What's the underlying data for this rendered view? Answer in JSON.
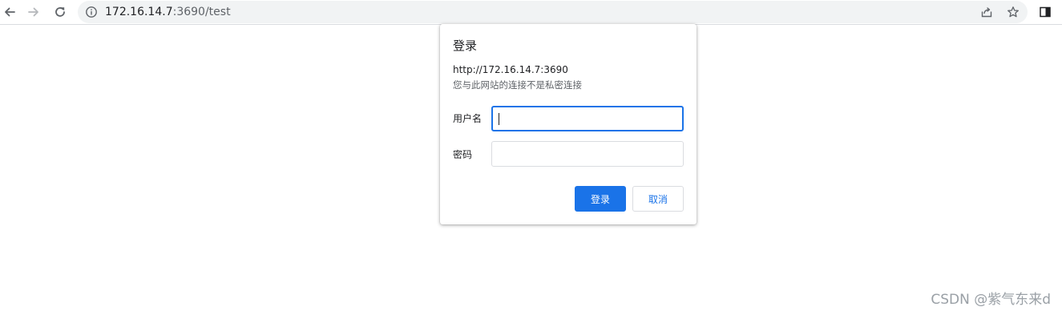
{
  "browser": {
    "address": {
      "host": "172.16.14.7",
      "rest": ":3690/test"
    },
    "icons": {
      "back": "arrow-left-icon",
      "forward": "arrow-right-icon",
      "reload": "reload-icon",
      "site_info": "info-icon",
      "share": "share-icon",
      "bookmark": "star-icon",
      "side_panel": "side-panel-icon"
    }
  },
  "dialog": {
    "title": "登录",
    "origin": "http://172.16.14.7:3690",
    "warning": "您与此网站的连接不是私密连接",
    "username_label": "用户名",
    "username_value": "",
    "password_label": "密码",
    "password_value": "",
    "login_button": "登录",
    "cancel_button": "取消"
  },
  "watermark": "CSDN @紫气东来d",
  "colors": {
    "accent": "#1a73e8",
    "omnibox_bg": "#f1f3f4",
    "secondary_text": "#5f6368"
  }
}
